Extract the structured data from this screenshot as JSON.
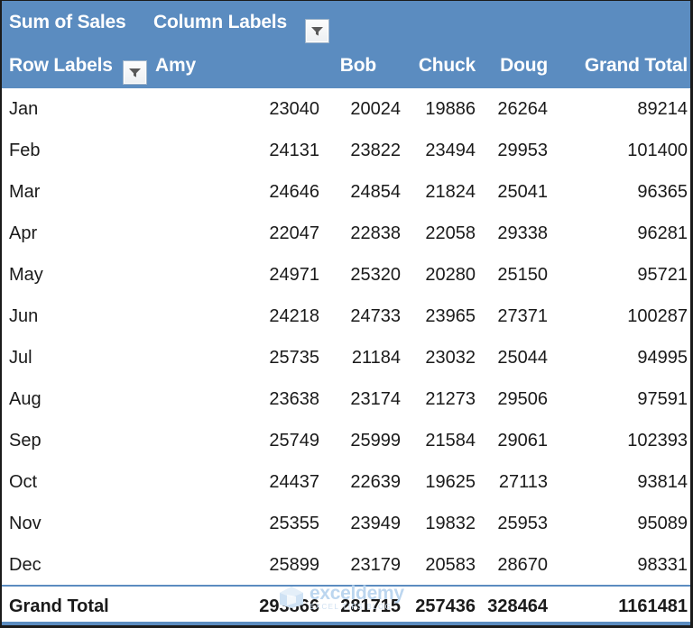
{
  "pivot": {
    "value_field_label": "Sum of Sales",
    "column_labels_label": "Column Labels",
    "row_labels_label": "Row Labels",
    "column_filter_icon": "filter-dropdown-icon",
    "row_filter_icon": "filter-dropdown-icon",
    "header_background": "#5b8cc0",
    "header_text_color": "#ffffff",
    "columns": [
      "Amy",
      "Bob",
      "Chuck",
      "Doug",
      "Grand Total"
    ],
    "rows": [
      {
        "label": "Jan",
        "values": [
          "23040",
          "20024",
          "19886",
          "26264",
          "89214"
        ]
      },
      {
        "label": "Feb",
        "values": [
          "24131",
          "23822",
          "23494",
          "29953",
          "101400"
        ]
      },
      {
        "label": "Mar",
        "values": [
          "24646",
          "24854",
          "21824",
          "25041",
          "96365"
        ]
      },
      {
        "label": "Apr",
        "values": [
          "22047",
          "22838",
          "22058",
          "29338",
          "96281"
        ]
      },
      {
        "label": "May",
        "values": [
          "24971",
          "25320",
          "20280",
          "25150",
          "95721"
        ]
      },
      {
        "label": "Jun",
        "values": [
          "24218",
          "24733",
          "23965",
          "27371",
          "100287"
        ]
      },
      {
        "label": "Jul",
        "values": [
          "25735",
          "21184",
          "23032",
          "25044",
          "94995"
        ]
      },
      {
        "label": "Aug",
        "values": [
          "23638",
          "23174",
          "21273",
          "29506",
          "97591"
        ]
      },
      {
        "label": "Sep",
        "values": [
          "25749",
          "25999",
          "21584",
          "29061",
          "102393"
        ]
      },
      {
        "label": "Oct",
        "values": [
          "24437",
          "22639",
          "19625",
          "27113",
          "93814"
        ]
      },
      {
        "label": "Nov",
        "values": [
          "25355",
          "23949",
          "19832",
          "25953",
          "95089"
        ]
      },
      {
        "label": "Dec",
        "values": [
          "25899",
          "23179",
          "20583",
          "28670",
          "98331"
        ]
      }
    ],
    "grand_total": {
      "label": "Grand Total",
      "values": [
        "293866",
        "281715",
        "257436",
        "328464",
        "1161481"
      ]
    }
  },
  "watermark": {
    "name": "exceldemy",
    "tagline": "EXCEL   TIPS   BLOG",
    "color": "#bcd6ef"
  }
}
